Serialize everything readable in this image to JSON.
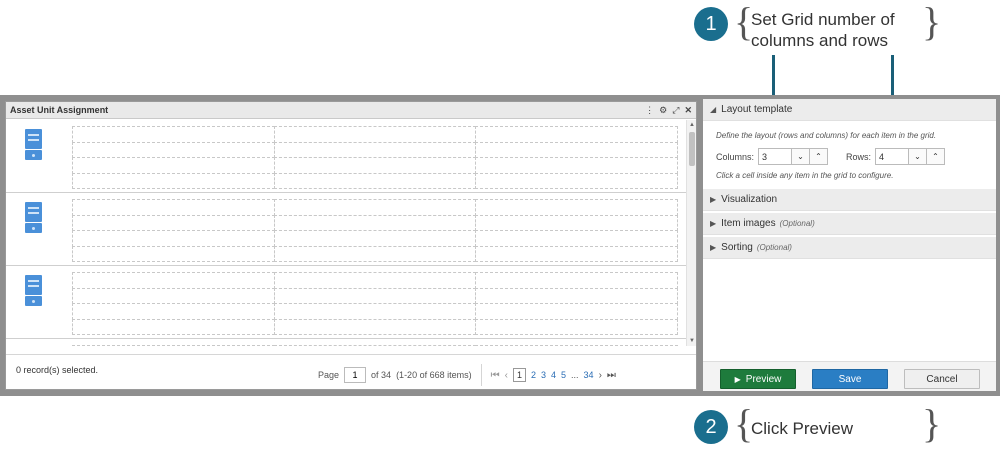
{
  "widget": {
    "title": "Asset Unit Assignment",
    "tools": {
      "menu": "⋮",
      "gear": "⚙",
      "expand": "⤢",
      "close": "✕"
    },
    "footer": {
      "selection": "0 record(s) selected.",
      "page_label": "Page",
      "page_value": "1",
      "of_text": "of 34",
      "range_text": "(1-20 of 668 items)",
      "pages": [
        "1",
        "2",
        "3",
        "4",
        "5",
        "...",
        "34"
      ]
    }
  },
  "panel": {
    "layout_header": "Layout template",
    "layout_desc": "Define the layout (rows and columns) for each item in the grid.",
    "columns_label": "Columns:",
    "columns_value": "3",
    "rows_label": "Rows:",
    "rows_value": "4",
    "hint": "Click a cell inside any item in the grid to configure.",
    "sections": [
      {
        "label": "Visualization",
        "optional": ""
      },
      {
        "label": "Item images",
        "optional": "(Optional)"
      },
      {
        "label": "Sorting",
        "optional": "(Optional)"
      }
    ],
    "buttons": {
      "preview": "Preview",
      "save": "Save",
      "cancel": "Cancel"
    }
  },
  "callouts": [
    {
      "number": "1",
      "text_line1": "Set Grid number of",
      "text_line2": "columns and rows"
    },
    {
      "number": "2",
      "text_line1": "Click Preview"
    }
  ],
  "colors": {
    "badge": "#1a6e8e",
    "preview": "#1e7b3c",
    "save": "#2a7ec4",
    "device_icon": "#4a90d9"
  },
  "icons": [
    "server-icon",
    "kebab-menu-icon",
    "gear-icon",
    "expand-icon",
    "close-icon",
    "caret-right-icon",
    "caret-down-icon",
    "chevron-up-icon",
    "chevron-down-icon",
    "play-icon"
  ]
}
